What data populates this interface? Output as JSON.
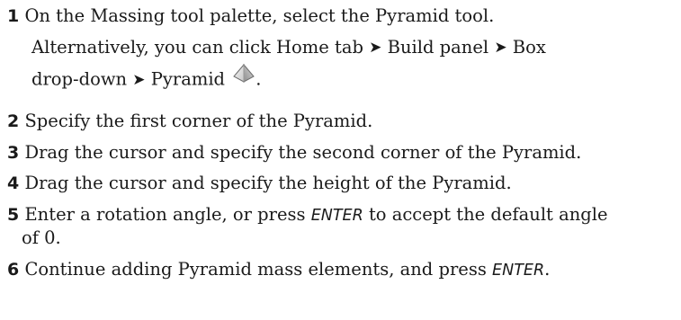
{
  "steps": [
    {
      "num": "1",
      "text": "On the Massing tool palette, select the Pyramid tool."
    },
    {
      "num": "2",
      "text": "Specify the first corner of the Pyramid."
    },
    {
      "num": "3",
      "text": "Drag the cursor and specify the second corner of the Pyramid."
    },
    {
      "num": "4",
      "text": "Drag the cursor and specify the height of the Pyramid."
    },
    {
      "num": "5",
      "text_a": "Enter a rotation angle, or press ",
      "enter": "ENTER",
      "text_b": " to accept the default angle",
      "text_c": "of 0."
    },
    {
      "num": "6",
      "text_a": "Continue adding Pyramid mass elements, and press ",
      "enter": "ENTER",
      "text_b": "."
    }
  ],
  "alternative": {
    "part1": "Alternatively, you can click Home tab",
    "part2": "Build panel",
    "part3": "Box",
    "part4": "drop-down",
    "part5": "Pyramid",
    "period": ".",
    "arrow": "➤"
  },
  "icons": {
    "pyramid": "pyramid-icon"
  }
}
